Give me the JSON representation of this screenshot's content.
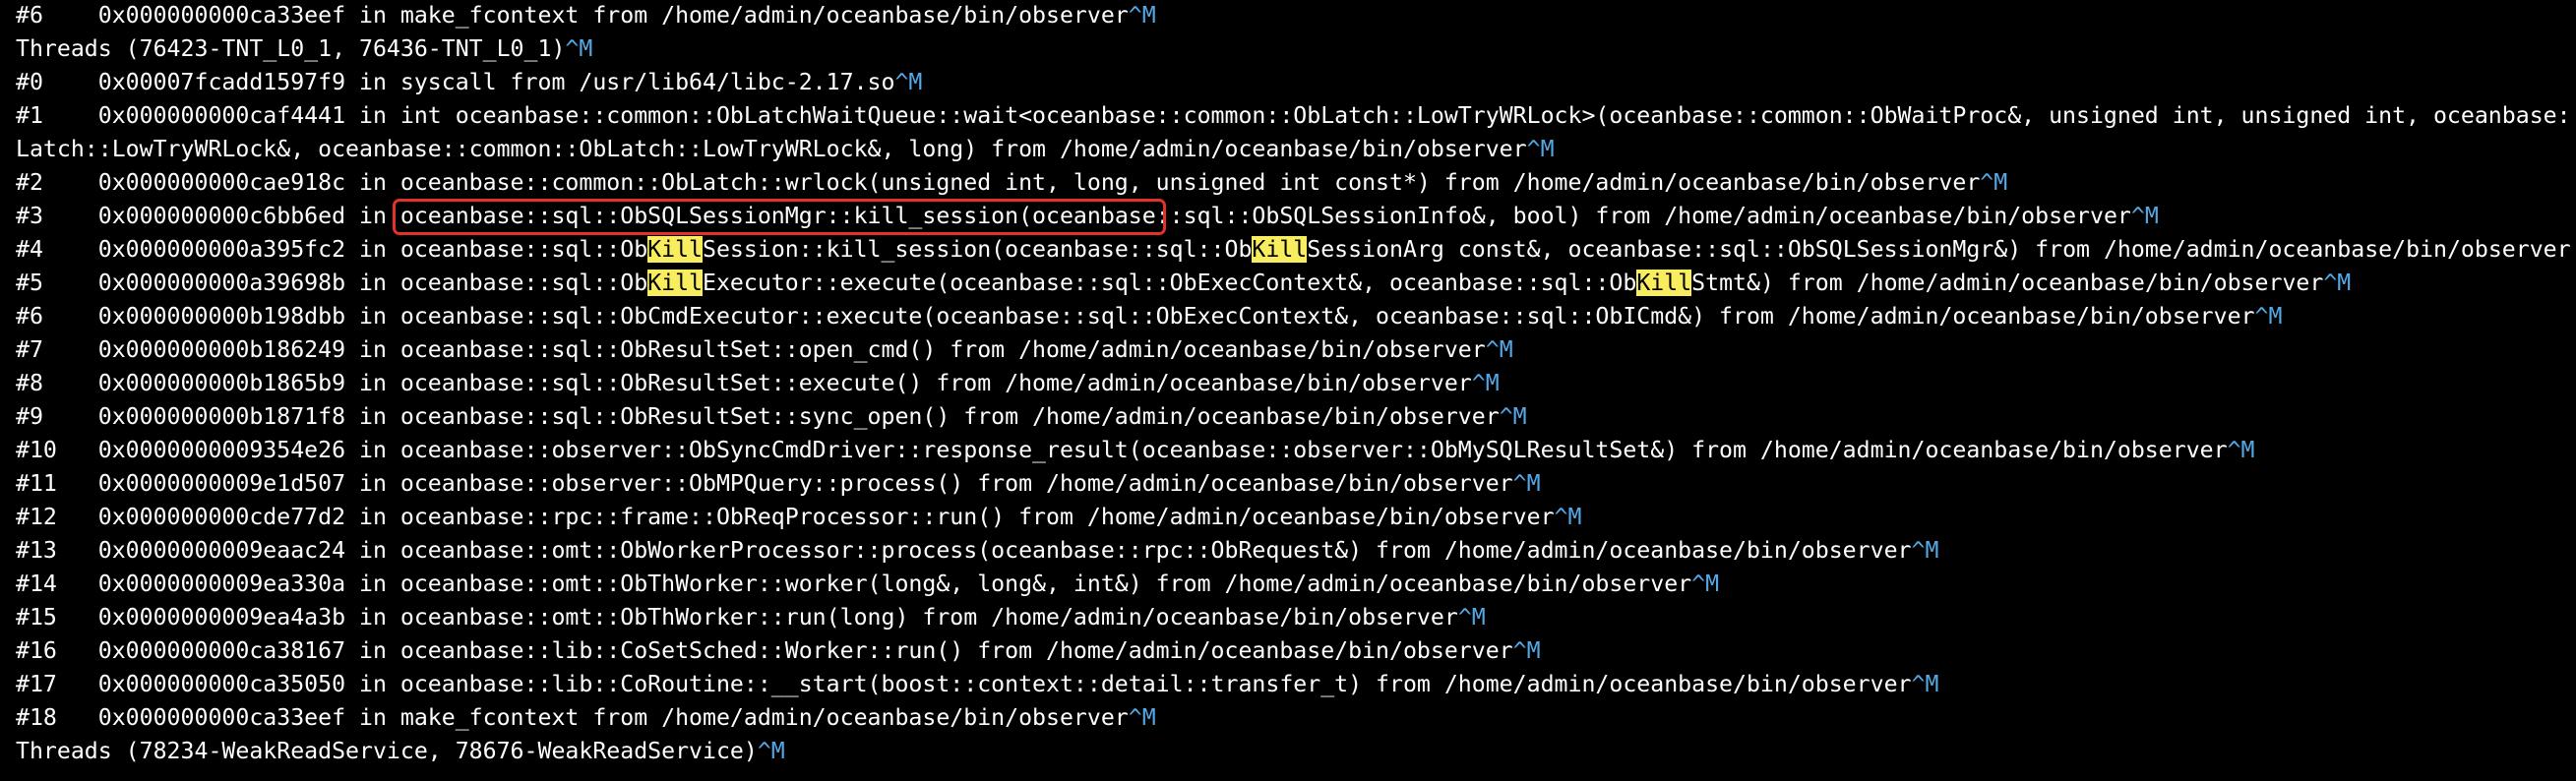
{
  "colors": {
    "background": "#000000",
    "text": "#ffffff",
    "control_char": "#53a8e6",
    "search_highlight": "#f7ed5e",
    "annotation_box": "#e5312b"
  },
  "search_match": "Kill",
  "control_char": "^M",
  "lines": [
    {
      "text": "#6    0x000000000ca33eef in make_fcontext from /home/admin/oceanbase/bin/observer"
    },
    {
      "text": "Threads (76423-TNT_L0_1, 76436-TNT_L0_1)"
    },
    {
      "text": "#0    0x00007fcadd1597f9 in syscall from /usr/lib64/libc-2.17.so"
    },
    {
      "text": "#1    0x000000000caf4441 in int oceanbase::common::ObLatchWaitQueue::wait<oceanbase::common::ObLatch::LowTryWRLock>(oceanbase::common::ObWaitProc&, unsigned int, unsigned int, oceanbase::common::Ob"
    },
    {
      "text": "Latch::LowTryWRLock&, oceanbase::common::ObLatch::LowTryWRLock&, long) from /home/admin/oceanbase/bin/observer"
    },
    {
      "text": "#2    0x000000000cae918c in oceanbase::common::ObLatch::wrlock(unsigned int, long, unsigned int const*) from /home/admin/oceanbase/bin/observer"
    },
    {
      "pre": "#3    0x000000000c6bb6ed in ",
      "boxed": "oceanbase::sql::ObSQLSessionMgr::kill_session(oceanbase",
      "text": "::sql::ObSQLSessionInfo&, bool) from /home/admin/oceanbase/bin/observer"
    },
    {
      "segments": [
        "#4    0x000000000a395fc2 in oceanbase::sql::Ob",
        "Kill",
        "Session::kill_session(oceanbase::sql::Ob",
        "Kill",
        "SessionArg const&, oceanbase::sql::ObSQLSessionMgr&) from /home/admin/oceanbase/bin/observer"
      ]
    },
    {
      "segments": [
        "#5    0x000000000a39698b in oceanbase::sql::Ob",
        "Kill",
        "Executor::execute(oceanbase::sql::ObExecContext&, oceanbase::sql::Ob",
        "Kill",
        "Stmt&) from /home/admin/oceanbase/bin/observer"
      ]
    },
    {
      "text": "#6    0x000000000b198dbb in oceanbase::sql::ObCmdExecutor::execute(oceanbase::sql::ObExecContext&, oceanbase::sql::ObICmd&) from /home/admin/oceanbase/bin/observer"
    },
    {
      "text": "#7    0x000000000b186249 in oceanbase::sql::ObResultSet::open_cmd() from /home/admin/oceanbase/bin/observer"
    },
    {
      "text": "#8    0x000000000b1865b9 in oceanbase::sql::ObResultSet::execute() from /home/admin/oceanbase/bin/observer"
    },
    {
      "text": "#9    0x000000000b1871f8 in oceanbase::sql::ObResultSet::sync_open() from /home/admin/oceanbase/bin/observer"
    },
    {
      "text": "#10   0x0000000009354e26 in oceanbase::observer::ObSyncCmdDriver::response_result(oceanbase::observer::ObMySQLResultSet&) from /home/admin/oceanbase/bin/observer"
    },
    {
      "text": "#11   0x0000000009e1d507 in oceanbase::observer::ObMPQuery::process() from /home/admin/oceanbase/bin/observer"
    },
    {
      "text": "#12   0x000000000cde77d2 in oceanbase::rpc::frame::ObReqProcessor::run() from /home/admin/oceanbase/bin/observer"
    },
    {
      "text": "#13   0x0000000009eaac24 in oceanbase::omt::ObWorkerProcessor::process(oceanbase::rpc::ObRequest&) from /home/admin/oceanbase/bin/observer"
    },
    {
      "text": "#14   0x0000000009ea330a in oceanbase::omt::ObThWorker::worker(long&, long&, int&) from /home/admin/oceanbase/bin/observer"
    },
    {
      "text": "#15   0x0000000009ea4a3b in oceanbase::omt::ObThWorker::run(long) from /home/admin/oceanbase/bin/observer"
    },
    {
      "text": "#16   0x000000000ca38167 in oceanbase::lib::CoSetSched::Worker::run() from /home/admin/oceanbase/bin/observer"
    },
    {
      "text": "#17   0x000000000ca35050 in oceanbase::lib::CoRoutine::__start(boost::context::detail::transfer_t) from /home/admin/oceanbase/bin/observer"
    },
    {
      "text": "#18   0x000000000ca33eef in make_fcontext from /home/admin/oceanbase/bin/observer"
    },
    {
      "text": "Threads (78234-WeakReadService, 78676-WeakReadService)"
    }
  ]
}
